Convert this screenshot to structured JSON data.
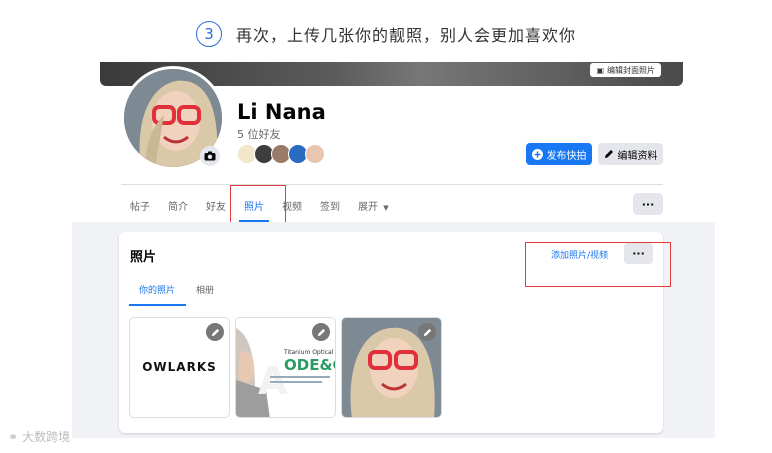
{
  "step": {
    "number": "3",
    "text": "再次，上传几张你的靓照，别人会更加喜欢你"
  },
  "cover": {
    "edit_label": "编辑封面照片"
  },
  "profile": {
    "name": "Li Nana",
    "friends": "5 位好友"
  },
  "actions": {
    "post_label": "发布快拍",
    "edit_label": "编辑资料"
  },
  "tabs": [
    {
      "label": "帖子"
    },
    {
      "label": "简介"
    },
    {
      "label": "好友"
    },
    {
      "label": "照片"
    },
    {
      "label": "视频"
    },
    {
      "label": "签到"
    },
    {
      "label": "展开"
    }
  ],
  "more_label": "···",
  "photos": {
    "title": "照片",
    "add_label": "添加照片/视频",
    "more_label": "···",
    "subtabs": [
      {
        "label": "你的照片"
      },
      {
        "label": "相册"
      }
    ],
    "items": [
      {
        "text": "OWLARKS"
      },
      {
        "brand": "Titanium Optical",
        "code": "ODE&C"
      },
      {
        "text": ""
      }
    ]
  },
  "watermark": "大数跨境",
  "colors": {
    "accent": "#1877f2",
    "highlight": "#e23b3b",
    "step": "#2d6fd9"
  }
}
